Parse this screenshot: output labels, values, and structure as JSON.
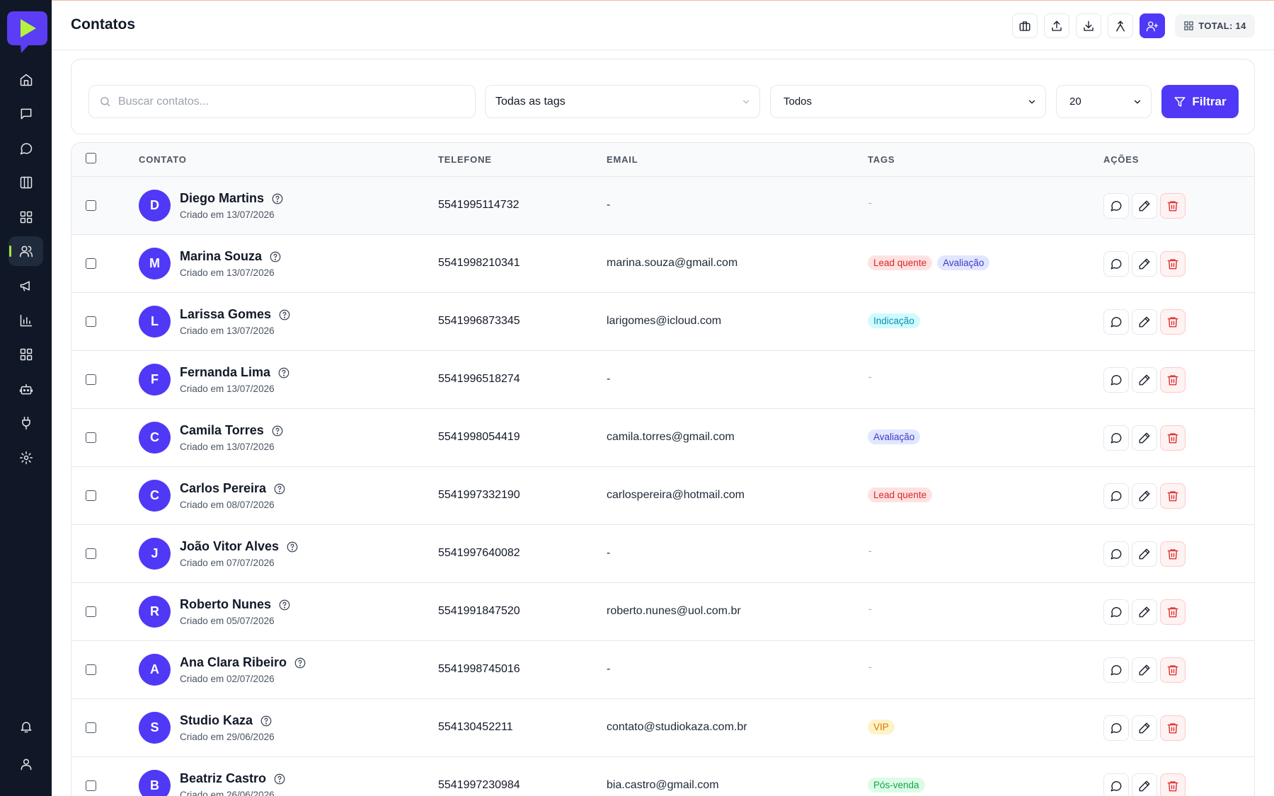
{
  "header": {
    "title": "Contatos",
    "total_label": "TOTAL: 14"
  },
  "colors": {
    "accent": "#4f39f6",
    "sidebar_bg": "#101726",
    "logo_bubble": "#5b3df5",
    "logo_play": "#b6f23d",
    "danger": "#dc2626"
  },
  "sidebar": {
    "items": [
      {
        "icon": "home-icon"
      },
      {
        "icon": "message-square-icon"
      },
      {
        "icon": "message-circle-icon"
      },
      {
        "icon": "kanban-icon"
      },
      {
        "icon": "apps-icon"
      },
      {
        "icon": "users-icon",
        "active": true
      },
      {
        "icon": "megaphone-icon"
      },
      {
        "icon": "bar-chart-icon"
      },
      {
        "icon": "grid-icon"
      },
      {
        "icon": "bot-icon"
      },
      {
        "icon": "plug-icon"
      },
      {
        "icon": "settings-icon"
      },
      {
        "icon": "bell-icon"
      },
      {
        "icon": "user-icon"
      }
    ]
  },
  "header_actions": [
    "briefcase-icon",
    "upload-icon",
    "download-icon",
    "merge-icon",
    "add-user-icon"
  ],
  "filters": {
    "search_placeholder": "Buscar contatos...",
    "tags_select": "Todas as tags",
    "status_select": "Todos",
    "page_size": "20",
    "filter_button": "Filtrar"
  },
  "table": {
    "columns": {
      "contact": "CONTATO",
      "phone": "TELEFONE",
      "email": "EMAIL",
      "tags": "TAGS",
      "actions": "AÇÕES"
    },
    "rows": [
      {
        "initial": "D",
        "name": "Diego Martins",
        "created": "Criado em 13/07/2026",
        "phone": "5541995114732",
        "email": "-",
        "tags": []
      },
      {
        "initial": "M",
        "name": "Marina Souza",
        "created": "Criado em 13/07/2026",
        "phone": "5541998210341",
        "email": "marina.souza@gmail.com",
        "tags": [
          {
            "label": "Lead quente",
            "kind": "red"
          },
          {
            "label": "Avaliação",
            "kind": "purple"
          }
        ]
      },
      {
        "initial": "L",
        "name": "Larissa Gomes",
        "created": "Criado em 13/07/2026",
        "phone": "5541996873345",
        "email": "larigomes@icloud.com",
        "tags": [
          {
            "label": "Indicação",
            "kind": "cyan"
          }
        ]
      },
      {
        "initial": "F",
        "name": "Fernanda Lima",
        "created": "Criado em 13/07/2026",
        "phone": "5541996518274",
        "email": "-",
        "tags": []
      },
      {
        "initial": "C",
        "name": "Camila Torres",
        "created": "Criado em 13/07/2026",
        "phone": "5541998054419",
        "email": "camila.torres@gmail.com",
        "tags": [
          {
            "label": "Avaliação",
            "kind": "purple"
          }
        ]
      },
      {
        "initial": "C",
        "name": "Carlos Pereira",
        "created": "Criado em 08/07/2026",
        "phone": "5541997332190",
        "email": "carlospereira@hotmail.com",
        "tags": [
          {
            "label": "Lead quente",
            "kind": "red"
          }
        ]
      },
      {
        "initial": "J",
        "name": "João Vitor Alves",
        "created": "Criado em 07/07/2026",
        "phone": "5541997640082",
        "email": "-",
        "tags": []
      },
      {
        "initial": "R",
        "name": "Roberto Nunes",
        "created": "Criado em 05/07/2026",
        "phone": "5541991847520",
        "email": "roberto.nunes@uol.com.br",
        "tags": []
      },
      {
        "initial": "A",
        "name": "Ana Clara Ribeiro",
        "created": "Criado em 02/07/2026",
        "phone": "5541998745016",
        "email": "-",
        "tags": []
      },
      {
        "initial": "S",
        "name": "Studio Kaza",
        "created": "Criado em 29/06/2026",
        "phone": "554130452211",
        "email": "contato@studiokaza.com.br",
        "tags": [
          {
            "label": "VIP",
            "kind": "amber"
          }
        ]
      },
      {
        "initial": "B",
        "name": "Beatriz Castro",
        "created": "Criado em 26/06/2026",
        "phone": "5541997230984",
        "email": "bia.castro@gmail.com",
        "tags": [
          {
            "label": "Pós-venda",
            "kind": "green"
          }
        ]
      }
    ],
    "empty_tag": "-"
  },
  "tag_colors": {
    "red": {
      "bg": "#fee2e2",
      "fg": "#dc2626"
    },
    "purple": {
      "bg": "#e0e7ff",
      "fg": "#4338ca"
    },
    "cyan": {
      "bg": "#cffafe",
      "fg": "#0891b2"
    },
    "amber": {
      "bg": "#fef3c7",
      "fg": "#d97706"
    },
    "green": {
      "bg": "#dcfce7",
      "fg": "#16a34a"
    }
  }
}
